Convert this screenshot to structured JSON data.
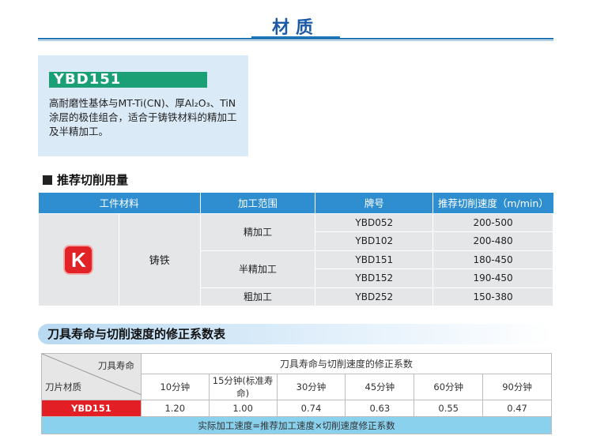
{
  "header": {
    "title": "材质"
  },
  "material": {
    "grade": "YBD151",
    "description_lines": [
      "高耐磨性基体与MT-Ti(CN)、厚Al₂O₃、TiN",
      "涂层的极佳组合，适合于铸铁材料的精加工",
      "及半精加工。"
    ]
  },
  "cutting": {
    "section_title": "推荐切削用量",
    "headers": [
      "工件材料",
      "加工范围",
      "牌号",
      "推荐切削速度（m/min）"
    ],
    "material_badge": "K",
    "material_name": "铸铁",
    "ranges": [
      "精加工",
      "半精加工",
      "粗加工"
    ],
    "rows": [
      {
        "grade": "YBD052",
        "speed": "200-500"
      },
      {
        "grade": "YBD102",
        "speed": "200-480"
      },
      {
        "grade": "YBD151",
        "speed": "180-450"
      },
      {
        "grade": "YBD152",
        "speed": "190-450"
      },
      {
        "grade": "YBD252",
        "speed": "150-380"
      }
    ],
    "colors": {
      "header_bg": "#2e8ed0",
      "cell_bg": "#e4e6e8",
      "badge": "#e12227"
    }
  },
  "correction": {
    "section_title": "刀具寿命与切削速度的修正系数表",
    "corner_top": "刀具寿命",
    "corner_bottom": "刀片材质",
    "span_header": "刀具寿命与切削速度的修正系数",
    "minutes": [
      "10分钟",
      "15分钟(标准寿命)",
      "30分钟",
      "45分钟",
      "60分钟",
      "90分钟"
    ],
    "grade": "YBD151",
    "coefficients": [
      "1.20",
      "1.00",
      "0.74",
      "0.63",
      "0.55",
      "0.47"
    ],
    "formula": "实际加工速度=推荐加工速度×切削速度修正系数",
    "colors": {
      "grade_bg": "#e31e24",
      "formula_bg": "#8ad1ee"
    }
  }
}
